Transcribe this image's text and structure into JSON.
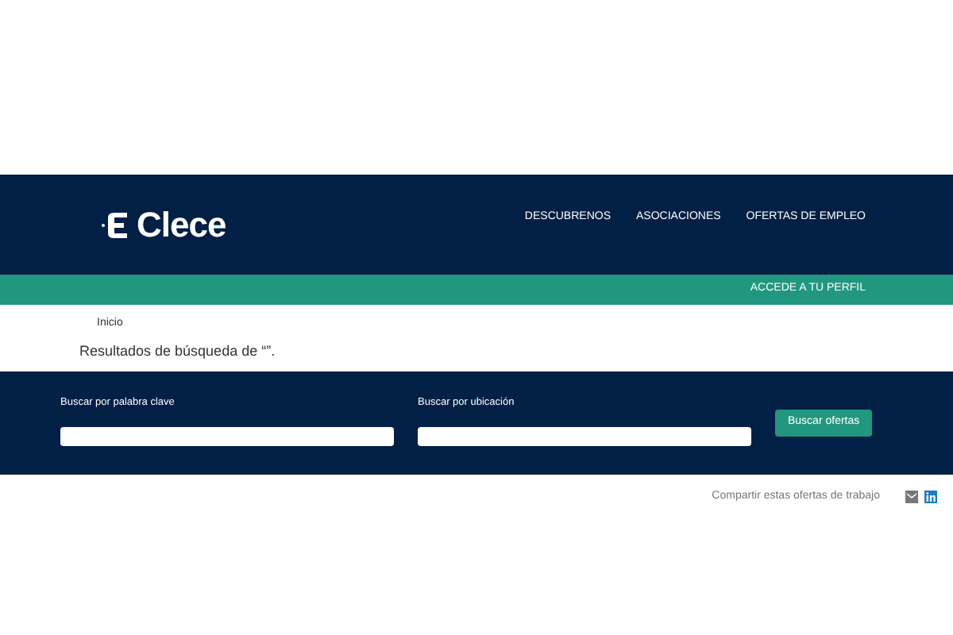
{
  "logo": {
    "text": "Clece"
  },
  "nav": [
    "DESCUBRENOS",
    "ASOCIACIONES",
    "OFERTAS DE EMPLEO"
  ],
  "profile_link": "ACCEDE A TU PERFIL",
  "breadcrumb": [
    "Inicio"
  ],
  "results_title": "Resultados de búsqueda de “”.",
  "search": {
    "fields": [
      {
        "label": "Buscar por palabra clave"
      },
      {
        "label": "Buscar por ubicación"
      }
    ],
    "button": "Buscar ofertas"
  },
  "share": {
    "text": "Compartir estas ofertas de trabajo",
    "icons": [
      {
        "kind": "email"
      },
      {
        "kind": "linkedin"
      }
    ]
  }
}
